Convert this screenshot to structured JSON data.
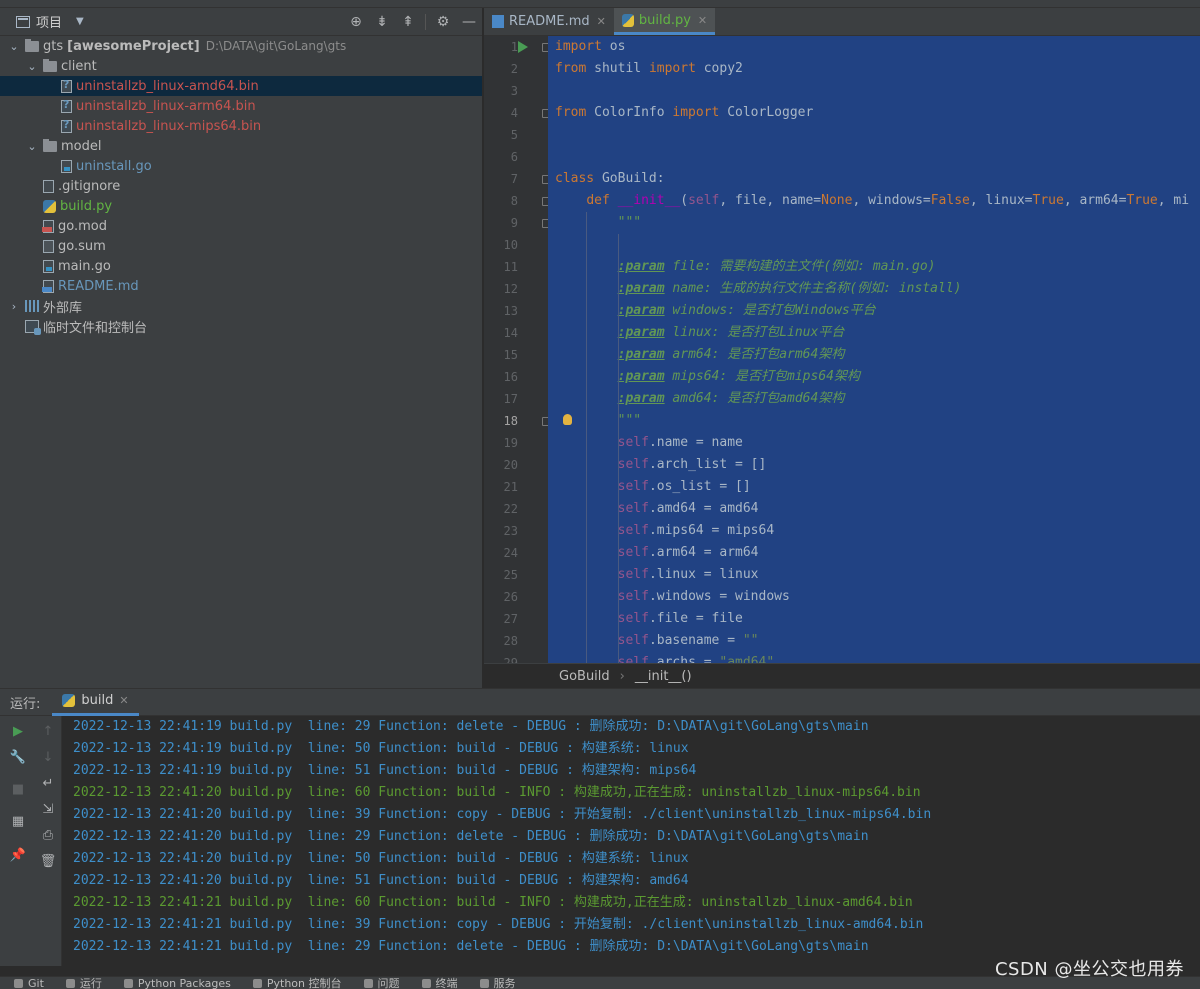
{
  "project_panel": {
    "title": "项目",
    "tree": [
      {
        "depth": 0,
        "chevron": "down",
        "icon": "folder",
        "label": "gts",
        "bold_suffix": "[awesomeProject]",
        "path": "D:\\DATA\\git\\GoLang\\gts",
        "color": "white"
      },
      {
        "depth": 1,
        "chevron": "down",
        "icon": "folder",
        "label": "client",
        "color": "white"
      },
      {
        "depth": 2,
        "chevron": "",
        "icon": "binf",
        "label": "uninstallzb_linux-amd64.bin",
        "color": "red",
        "selected": true
      },
      {
        "depth": 2,
        "chevron": "",
        "icon": "binf",
        "label": "uninstallzb_linux-arm64.bin",
        "color": "red"
      },
      {
        "depth": 2,
        "chevron": "",
        "icon": "binf",
        "label": "uninstallzb_linux-mips64.bin",
        "color": "red"
      },
      {
        "depth": 1,
        "chevron": "down",
        "icon": "folder",
        "label": "model",
        "color": "white"
      },
      {
        "depth": 2,
        "chevron": "",
        "icon": "gof",
        "label": "uninstall.go",
        "color": "blue"
      },
      {
        "depth": 1,
        "chevron": "",
        "icon": "gitf",
        "label": ".gitignore",
        "color": "white"
      },
      {
        "depth": 1,
        "chevron": "",
        "icon": "pyf",
        "label": "build.py",
        "color": "green"
      },
      {
        "depth": 1,
        "chevron": "",
        "icon": "modf",
        "label": "go.mod",
        "color": "white"
      },
      {
        "depth": 1,
        "chevron": "",
        "icon": "file",
        "label": "go.sum",
        "color": "white"
      },
      {
        "depth": 1,
        "chevron": "",
        "icon": "gof",
        "label": "main.go",
        "color": "white"
      },
      {
        "depth": 1,
        "chevron": "",
        "icon": "mdf",
        "label": "README.md",
        "color": "blue"
      },
      {
        "depth": 0,
        "chevron": "right",
        "icon": "libs",
        "label": "外部库",
        "color": "white"
      },
      {
        "depth": 0,
        "chevron": "",
        "icon": "scratch",
        "label": "临时文件和控制台",
        "color": "white"
      }
    ]
  },
  "editor": {
    "tabs": [
      {
        "label": "README.md",
        "icon": "md",
        "active": false
      },
      {
        "label": "build.py",
        "icon": "py",
        "active": true
      }
    ],
    "lines": [
      {
        "n": "1",
        "html": "<span class=\"kw\">import</span> os"
      },
      {
        "n": "2",
        "html": "<span class=\"kw\">from</span> shutil <span class=\"kw\">import</span> copy2"
      },
      {
        "n": "3",
        "html": ""
      },
      {
        "n": "4",
        "html": "<span class=\"kw\">from</span> ColorInfo <span class=\"kw\">import</span> ColorLogger"
      },
      {
        "n": "5",
        "html": ""
      },
      {
        "n": "6",
        "html": ""
      },
      {
        "n": "7",
        "html": "<span class=\"kw\">class</span> GoBuild:"
      },
      {
        "n": "8",
        "html": "    <span class=\"kw\">def</span> <span class=\"fn\">__init__</span>(<span class=\"self\">self</span>, file, name=<span class=\"kw\">None</span>, windows=<span class=\"kw\">False</span>, linux=<span class=\"kw\">True</span>, arm64=<span class=\"kw\">True</span>, mi"
      },
      {
        "n": "9",
        "html": "        <span class=\"doc\">\"\"\"</span>"
      },
      {
        "n": "10",
        "html": ""
      },
      {
        "n": "11",
        "html": "        <span class=\"doctag\">:param</span><span class=\"doc\"> file: 需要构建的主文件(例如: main.go)</span>"
      },
      {
        "n": "12",
        "html": "        <span class=\"doctag\">:param</span><span class=\"doc\"> name: 生成的执行文件主名称(例如: install)</span>"
      },
      {
        "n": "13",
        "html": "        <span class=\"doctag\">:param</span><span class=\"doc\"> windows: 是否打包Windows平台</span>"
      },
      {
        "n": "14",
        "html": "        <span class=\"doctag\">:param</span><span class=\"doc\"> linux: 是否打包Linux平台</span>"
      },
      {
        "n": "15",
        "html": "        <span class=\"doctag\">:param</span><span class=\"doc\"> arm64: 是否打包arm64架构</span>"
      },
      {
        "n": "16",
        "html": "        <span class=\"doctag\">:param</span><span class=\"doc\"> mips64: 是否打包mips64架构</span>"
      },
      {
        "n": "17",
        "html": "        <span class=\"doctag\">:param</span><span class=\"doc\"> amd64: 是否打包amd64架构</span>"
      },
      {
        "n": "18",
        "html": "        <span class=\"doc\">\"\"\"</span>"
      },
      {
        "n": "19",
        "html": "        <span class=\"self\">self</span>.name = name"
      },
      {
        "n": "20",
        "html": "        <span class=\"self\">self</span>.arch_list = []"
      },
      {
        "n": "21",
        "html": "        <span class=\"self\">self</span>.os_list = []"
      },
      {
        "n": "22",
        "html": "        <span class=\"self\">self</span>.amd64 = amd64"
      },
      {
        "n": "23",
        "html": "        <span class=\"self\">self</span>.mips64 = mips64"
      },
      {
        "n": "24",
        "html": "        <span class=\"self\">self</span>.arm64 = arm64"
      },
      {
        "n": "25",
        "html": "        <span class=\"self\">self</span>.linux = linux"
      },
      {
        "n": "26",
        "html": "        <span class=\"self\">self</span>.windows = windows"
      },
      {
        "n": "27",
        "html": "        <span class=\"self\">self</span>.file = file"
      },
      {
        "n": "28",
        "html": "        <span class=\"self\">self</span>.basename = <span class=\"str\">\"\"</span>"
      },
      {
        "n": "29",
        "html": "        <span class=\"self\">self</span>.archs = <span class=\"str\">\"amd64\"</span>"
      }
    ],
    "breadcrumbs": [
      "GoBuild",
      "__init__()"
    ]
  },
  "run_panel": {
    "label": "运行:",
    "tab": "build",
    "log": [
      {
        "level": "DEBUG",
        "text": "2022-12-13 22:41:19 build.py  line: 29 Function: delete - DEBUG : 删除成功: D:\\DATA\\git\\GoLang\\gts\\main"
      },
      {
        "level": "DEBUG",
        "text": "2022-12-13 22:41:19 build.py  line: 50 Function: build - DEBUG : 构建系统: linux"
      },
      {
        "level": "DEBUG",
        "text": "2022-12-13 22:41:19 build.py  line: 51 Function: build - DEBUG : 构建架构: mips64"
      },
      {
        "level": "INFO",
        "text": "2022-12-13 22:41:20 build.py  line: 60 Function: build - INFO : 构建成功,正在生成: uninstallzb_linux-mips64.bin"
      },
      {
        "level": "DEBUG",
        "text": "2022-12-13 22:41:20 build.py  line: 39 Function: copy - DEBUG : 开始复制: ./client\\uninstallzb_linux-mips64.bin"
      },
      {
        "level": "DEBUG",
        "text": "2022-12-13 22:41:20 build.py  line: 29 Function: delete - DEBUG : 删除成功: D:\\DATA\\git\\GoLang\\gts\\main"
      },
      {
        "level": "DEBUG",
        "text": "2022-12-13 22:41:20 build.py  line: 50 Function: build - DEBUG : 构建系统: linux"
      },
      {
        "level": "DEBUG",
        "text": "2022-12-13 22:41:20 build.py  line: 51 Function: build - DEBUG : 构建架构: amd64"
      },
      {
        "level": "INFO",
        "text": "2022-12-13 22:41:21 build.py  line: 60 Function: build - INFO : 构建成功,正在生成: uninstallzb_linux-amd64.bin"
      },
      {
        "level": "DEBUG",
        "text": "2022-12-13 22:41:21 build.py  line: 39 Function: copy - DEBUG : 开始复制: ./client\\uninstallzb_linux-amd64.bin"
      },
      {
        "level": "DEBUG",
        "text": "2022-12-13 22:41:21 build.py  line: 29 Function: delete - DEBUG : 删除成功: D:\\DATA\\git\\GoLang\\gts\\main"
      }
    ]
  },
  "status_bar": {
    "items": [
      "Git",
      "运行",
      "Python Packages",
      "Python 控制台",
      "问题",
      "终端",
      "服务"
    ]
  },
  "watermark": "CSDN @坐公交也用券",
  "colors": {
    "selection": "#214283",
    "debug": "#3e8fca",
    "info": "#5b9a31",
    "untracked": "#c75450"
  }
}
